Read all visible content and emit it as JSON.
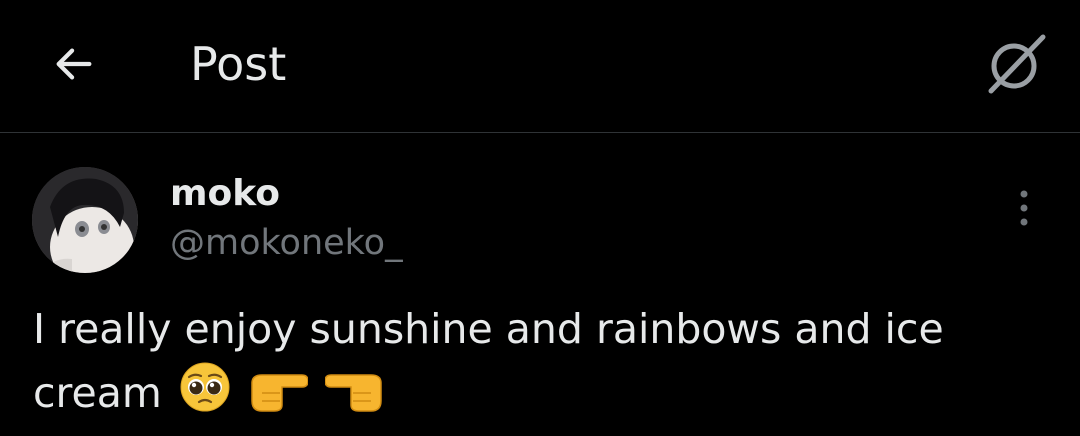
{
  "header": {
    "title": "Post",
    "back_icon": "arrow-left-icon",
    "grok_icon": "grok-icon"
  },
  "post": {
    "author": {
      "display_name": "moko",
      "handle": "@mokoneko_"
    },
    "text_line1": "I really enjoy sunshine and rainbows and ice",
    "text_line2": "cream",
    "emojis": [
      "pleading-face",
      "backhand-index-pointing-right",
      "backhand-index-pointing-left"
    ],
    "more_icon": "more-vertical-icon"
  },
  "colors": {
    "background": "#000000",
    "text_primary": "#e7e9ea",
    "text_secondary": "#71767b",
    "divider": "#2f3336"
  }
}
